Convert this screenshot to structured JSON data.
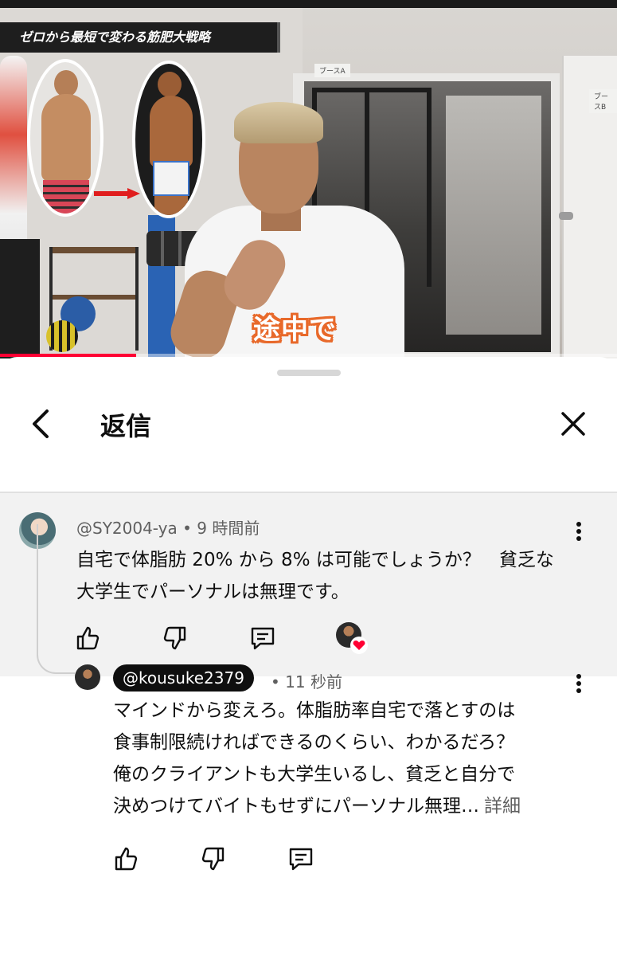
{
  "video": {
    "banner_title": "ゼロから最短で変わる筋肥大戦略",
    "caption": "途中で",
    "booth_a_sign": "ブースA",
    "booth_b_sign": "ブースB",
    "progress_fraction": 0.22,
    "accent_color": "#ff0033"
  },
  "sheet": {
    "title": "返信",
    "icons": {
      "back": "chevron-left-icon",
      "close": "close-icon"
    }
  },
  "parent_comment": {
    "author": "@SY2004-ya",
    "separator": "•",
    "time": "9 時間前",
    "text": "自宅で体脂肪 20% から 8% は可能でしょうか？　貧乏な大学生でパーソナルは無理です。",
    "actions": [
      "thumbs-up-icon",
      "thumbs-down-icon",
      "reply-icon",
      "creator-heart-icon"
    ],
    "heart_color": "#ff0033"
  },
  "reply": {
    "author": "@kousuke2379",
    "separator": "•",
    "time": "11 秒前",
    "lines": [
      "マインドから変えろ。体脂肪率自宅で落とすのは",
      "食事制限続ければできるのくらい、わかるだろ？",
      "俺のクライアントも大学生いるし、貧乏と自分で",
      "決めつけてバイトもせずにパーソナル無理…"
    ],
    "detail_label": "詳細",
    "actions": [
      "thumbs-up-icon",
      "thumbs-down-icon",
      "reply-icon"
    ]
  }
}
